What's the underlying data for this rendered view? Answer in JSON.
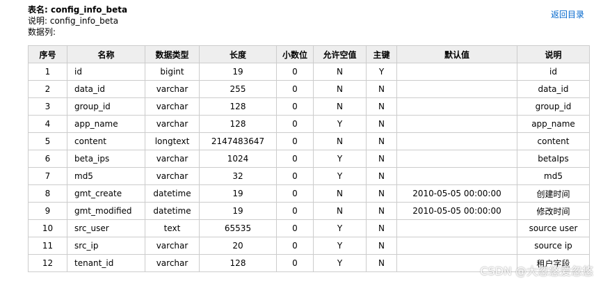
{
  "table": {
    "title": "表名: config_info_beta",
    "description": "说明: config_info_beta",
    "columns_label": "数据列:"
  },
  "nav": {
    "back_label": "返回目录"
  },
  "grid": {
    "headers": [
      "序号",
      "名称",
      "数据类型",
      "长度",
      "小数位",
      "允许空值",
      "主键",
      "默认值",
      "说明"
    ],
    "rows": [
      [
        "1",
        "id",
        "bigint",
        "19",
        "0",
        "N",
        "Y",
        "",
        "id"
      ],
      [
        "2",
        "data_id",
        "varchar",
        "255",
        "0",
        "N",
        "N",
        "",
        "data_id"
      ],
      [
        "3",
        "group_id",
        "varchar",
        "128",
        "0",
        "N",
        "N",
        "",
        "group_id"
      ],
      [
        "4",
        "app_name",
        "varchar",
        "128",
        "0",
        "Y",
        "N",
        "",
        "app_name"
      ],
      [
        "5",
        "content",
        "longtext",
        "2147483647",
        "0",
        "N",
        "N",
        "",
        "content"
      ],
      [
        "6",
        "beta_ips",
        "varchar",
        "1024",
        "0",
        "Y",
        "N",
        "",
        "betaIps"
      ],
      [
        "7",
        "md5",
        "varchar",
        "32",
        "0",
        "Y",
        "N",
        "",
        "md5"
      ],
      [
        "8",
        "gmt_create",
        "datetime",
        "19",
        "0",
        "N",
        "N",
        "2010-05-05 00:00:00",
        "创建时间"
      ],
      [
        "9",
        "gmt_modified",
        "datetime",
        "19",
        "0",
        "N",
        "N",
        "2010-05-05 00:00:00",
        "修改时间"
      ],
      [
        "10",
        "src_user",
        "text",
        "65535",
        "0",
        "Y",
        "N",
        "",
        "source user"
      ],
      [
        "11",
        "src_ip",
        "varchar",
        "20",
        "0",
        "Y",
        "N",
        "",
        "source ip"
      ],
      [
        "12",
        "tenant_id",
        "varchar",
        "128",
        "0",
        "Y",
        "N",
        "",
        "租户字段"
      ]
    ]
  },
  "watermark": "CSDN @大忽悠爱忽悠"
}
